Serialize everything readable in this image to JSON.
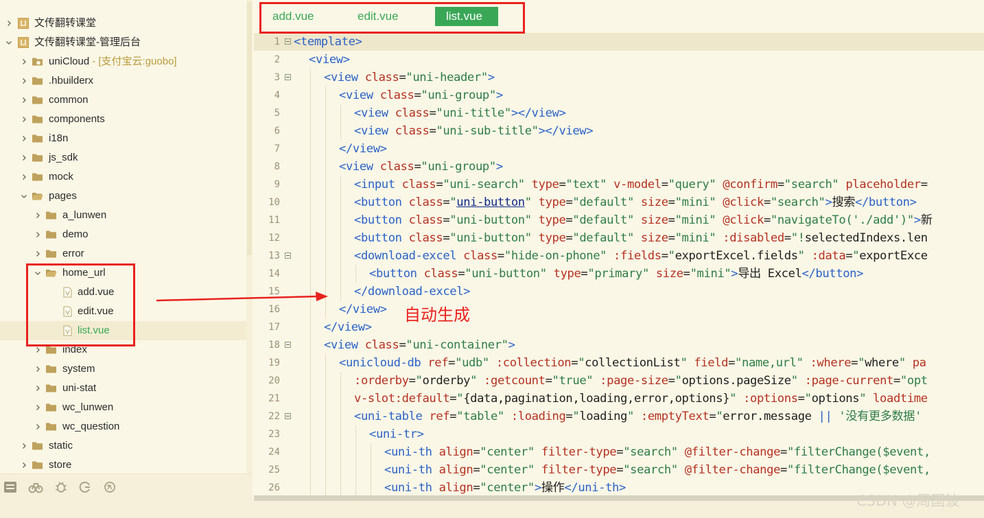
{
  "sidebar": {
    "projects": [
      {
        "name": "文传翻转课堂",
        "expanded": false
      },
      {
        "name": "文传翻转课堂-管理后台",
        "expanded": true
      }
    ],
    "tree": [
      {
        "label": "uniCloud",
        "extra": "- [支付宝云:guobo]",
        "type": "cloud-folder",
        "level": 1,
        "expanded": false
      },
      {
        "label": ".hbuilderx",
        "type": "folder",
        "level": 1,
        "expanded": false
      },
      {
        "label": "common",
        "type": "folder",
        "level": 1,
        "expanded": false
      },
      {
        "label": "components",
        "type": "folder",
        "level": 1,
        "expanded": false
      },
      {
        "label": "i18n",
        "type": "folder",
        "level": 1,
        "expanded": false
      },
      {
        "label": "js_sdk",
        "type": "folder",
        "level": 1,
        "expanded": false
      },
      {
        "label": "mock",
        "type": "folder",
        "level": 1,
        "expanded": false
      },
      {
        "label": "pages",
        "type": "folder",
        "level": 1,
        "expanded": true
      },
      {
        "label": "a_lunwen",
        "type": "folder",
        "level": 2,
        "expanded": false
      },
      {
        "label": "demo",
        "type": "folder",
        "level": 2,
        "expanded": false
      },
      {
        "label": "error",
        "type": "folder",
        "level": 2,
        "expanded": false
      },
      {
        "label": "home_url",
        "type": "folder",
        "level": 2,
        "expanded": true
      },
      {
        "label": "add.vue",
        "type": "file",
        "level": 3
      },
      {
        "label": "edit.vue",
        "type": "file",
        "level": 3
      },
      {
        "label": "list.vue",
        "type": "file",
        "level": 3,
        "selected": true
      },
      {
        "label": "index",
        "type": "folder",
        "level": 2,
        "expanded": false
      },
      {
        "label": "system",
        "type": "folder",
        "level": 2,
        "expanded": false
      },
      {
        "label": "uni-stat",
        "type": "folder",
        "level": 2,
        "expanded": false
      },
      {
        "label": "wc_lunwen",
        "type": "folder",
        "level": 2,
        "expanded": false
      },
      {
        "label": "wc_question",
        "type": "folder",
        "level": 2,
        "expanded": false
      },
      {
        "label": "static",
        "type": "folder",
        "level": 1,
        "expanded": false
      },
      {
        "label": "store",
        "type": "folder",
        "level": 1,
        "expanded": false
      }
    ],
    "toolbar_icons": [
      "project-manager-icon",
      "plugin-icon",
      "debug-icon",
      "git-icon",
      "translate-icon"
    ]
  },
  "editor": {
    "tabs": [
      {
        "label": "add.vue",
        "active": false
      },
      {
        "label": "edit.vue",
        "active": false
      },
      {
        "label": "list.vue",
        "active": true
      }
    ],
    "lines": [
      {
        "n": 1,
        "indent": 0,
        "fold": true,
        "current": true,
        "tokens": [
          [
            "tag",
            "<template>"
          ]
        ]
      },
      {
        "n": 2,
        "indent": 1,
        "tokens": [
          [
            "tag",
            "<view>"
          ]
        ]
      },
      {
        "n": 3,
        "indent": 2,
        "fold": true,
        "tokens": [
          [
            "tag",
            "<view "
          ],
          [
            "attr",
            "class"
          ],
          [
            "eq",
            "="
          ],
          [
            "val",
            "\"uni-header\""
          ],
          [
            "tag",
            ">"
          ]
        ]
      },
      {
        "n": 4,
        "indent": 3,
        "tokens": [
          [
            "tag",
            "<view "
          ],
          [
            "attr",
            "class"
          ],
          [
            "eq",
            "="
          ],
          [
            "val",
            "\"uni-group\""
          ],
          [
            "tag",
            ">"
          ]
        ]
      },
      {
        "n": 5,
        "indent": 4,
        "tokens": [
          [
            "tag",
            "<view "
          ],
          [
            "attr",
            "class"
          ],
          [
            "eq",
            "="
          ],
          [
            "val",
            "\"uni-title\""
          ],
          [
            "tag",
            "></view>"
          ]
        ]
      },
      {
        "n": 6,
        "indent": 4,
        "tokens": [
          [
            "tag",
            "<view "
          ],
          [
            "attr",
            "class"
          ],
          [
            "eq",
            "="
          ],
          [
            "val",
            "\"uni-sub-title\""
          ],
          [
            "tag",
            "></view>"
          ]
        ]
      },
      {
        "n": 7,
        "indent": 3,
        "tokens": [
          [
            "tag",
            "</view>"
          ]
        ]
      },
      {
        "n": 8,
        "indent": 3,
        "tokens": [
          [
            "tag",
            "<view "
          ],
          [
            "attr",
            "class"
          ],
          [
            "eq",
            "="
          ],
          [
            "val",
            "\"uni-group\""
          ],
          [
            "tag",
            ">"
          ]
        ]
      },
      {
        "n": 9,
        "indent": 4,
        "tokens": [
          [
            "tag",
            "<input "
          ],
          [
            "attr",
            "class"
          ],
          [
            "eq",
            "="
          ],
          [
            "val",
            "\"uni-search\" "
          ],
          [
            "attr",
            "type"
          ],
          [
            "eq",
            "="
          ],
          [
            "val",
            "\"text\" "
          ],
          [
            "attr",
            "v-model"
          ],
          [
            "eq",
            "="
          ],
          [
            "val",
            "\"query\" "
          ],
          [
            "attr",
            "@confirm"
          ],
          [
            "eq",
            "="
          ],
          [
            "val",
            "\"search\" "
          ],
          [
            "attr",
            "placeholder"
          ],
          [
            "eq",
            "="
          ]
        ]
      },
      {
        "n": 10,
        "indent": 4,
        "tokens": [
          [
            "tag",
            "<button "
          ],
          [
            "attr",
            "class"
          ],
          [
            "eq",
            "="
          ],
          [
            "val",
            "\""
          ],
          [
            "link",
            "uni-button"
          ],
          [
            "val",
            "\" "
          ],
          [
            "attr",
            "type"
          ],
          [
            "eq",
            "="
          ],
          [
            "val",
            "\"default\" "
          ],
          [
            "attr",
            "size"
          ],
          [
            "eq",
            "="
          ],
          [
            "val",
            "\"mini\" "
          ],
          [
            "attr",
            "@click"
          ],
          [
            "eq",
            "="
          ],
          [
            "val",
            "\"search\""
          ],
          [
            "tag",
            ">"
          ],
          [
            "text",
            "搜索"
          ],
          [
            "tag",
            "</button>"
          ]
        ]
      },
      {
        "n": 11,
        "indent": 4,
        "tokens": [
          [
            "tag",
            "<button "
          ],
          [
            "attr",
            "class"
          ],
          [
            "eq",
            "="
          ],
          [
            "val",
            "\"uni-button\" "
          ],
          [
            "attr",
            "type"
          ],
          [
            "eq",
            "="
          ],
          [
            "val",
            "\"default\" "
          ],
          [
            "attr",
            "size"
          ],
          [
            "eq",
            "="
          ],
          [
            "val",
            "\"mini\" "
          ],
          [
            "attr",
            "@click"
          ],
          [
            "eq",
            "="
          ],
          [
            "val",
            "\"navigateTo('./add')\""
          ],
          [
            "tag",
            ">"
          ],
          [
            "text",
            "新"
          ]
        ]
      },
      {
        "n": 12,
        "indent": 4,
        "tokens": [
          [
            "tag",
            "<button "
          ],
          [
            "attr",
            "class"
          ],
          [
            "eq",
            "="
          ],
          [
            "val",
            "\"uni-button\" "
          ],
          [
            "attr",
            "type"
          ],
          [
            "eq",
            "="
          ],
          [
            "val",
            "\"default\" "
          ],
          [
            "attr",
            "size"
          ],
          [
            "eq",
            "="
          ],
          [
            "val",
            "\"mini\" "
          ],
          [
            "attr",
            ":disabled"
          ],
          [
            "eq",
            "="
          ],
          [
            "val",
            "\"!"
          ],
          [
            "text",
            "selectedIndexs.len"
          ]
        ]
      },
      {
        "n": 13,
        "indent": 4,
        "fold": true,
        "tokens": [
          [
            "tag",
            "<download-excel "
          ],
          [
            "attr",
            "class"
          ],
          [
            "eq",
            "="
          ],
          [
            "val",
            "\"hide-on-phone\" "
          ],
          [
            "attr",
            ":fields"
          ],
          [
            "eq",
            "="
          ],
          [
            "val",
            "\""
          ],
          [
            "text",
            "exportExcel.fields"
          ],
          [
            "val",
            "\" "
          ],
          [
            "attr",
            ":data"
          ],
          [
            "eq",
            "="
          ],
          [
            "val",
            "\""
          ],
          [
            "text",
            "exportExce"
          ]
        ]
      },
      {
        "n": 14,
        "indent": 5,
        "tokens": [
          [
            "tag",
            "<button "
          ],
          [
            "attr",
            "class"
          ],
          [
            "eq",
            "="
          ],
          [
            "val",
            "\"uni-button\" "
          ],
          [
            "attr",
            "type"
          ],
          [
            "eq",
            "="
          ],
          [
            "val",
            "\"primary\" "
          ],
          [
            "attr",
            "size"
          ],
          [
            "eq",
            "="
          ],
          [
            "val",
            "\"mini\""
          ],
          [
            "tag",
            ">"
          ],
          [
            "text",
            "导出 Excel"
          ],
          [
            "tag",
            "</button>"
          ]
        ]
      },
      {
        "n": 15,
        "indent": 4,
        "tokens": [
          [
            "tag",
            "</download-excel>"
          ]
        ]
      },
      {
        "n": 16,
        "indent": 3,
        "tokens": [
          [
            "tag",
            "</view>"
          ]
        ]
      },
      {
        "n": 17,
        "indent": 2,
        "tokens": [
          [
            "tag",
            "</view>"
          ]
        ]
      },
      {
        "n": 18,
        "indent": 2,
        "fold": true,
        "tokens": [
          [
            "tag",
            "<view "
          ],
          [
            "attr",
            "class"
          ],
          [
            "eq",
            "="
          ],
          [
            "val",
            "\"uni-container\""
          ],
          [
            "tag",
            ">"
          ]
        ]
      },
      {
        "n": 19,
        "indent": 3,
        "tokens": [
          [
            "tag",
            "<unicloud-db "
          ],
          [
            "attr",
            "ref"
          ],
          [
            "eq",
            "="
          ],
          [
            "val",
            "\"udb\" "
          ],
          [
            "attr",
            ":collection"
          ],
          [
            "eq",
            "="
          ],
          [
            "val",
            "\""
          ],
          [
            "text",
            "collectionList"
          ],
          [
            "val",
            "\" "
          ],
          [
            "attr",
            "field"
          ],
          [
            "eq",
            "="
          ],
          [
            "val",
            "\"name,url\" "
          ],
          [
            "attr",
            ":where"
          ],
          [
            "eq",
            "="
          ],
          [
            "val",
            "\""
          ],
          [
            "text",
            "where"
          ],
          [
            "val",
            "\" "
          ],
          [
            "attr",
            "pa"
          ]
        ]
      },
      {
        "n": 20,
        "indent": 4,
        "tokens": [
          [
            "attr",
            ":orderby"
          ],
          [
            "eq",
            "="
          ],
          [
            "val",
            "\""
          ],
          [
            "text",
            "orderby"
          ],
          [
            "val",
            "\" "
          ],
          [
            "attr",
            ":getcount"
          ],
          [
            "eq",
            "="
          ],
          [
            "val",
            "\"true\" "
          ],
          [
            "attr",
            ":page-size"
          ],
          [
            "eq",
            "="
          ],
          [
            "val",
            "\""
          ],
          [
            "text",
            "options.pageSize"
          ],
          [
            "val",
            "\" "
          ],
          [
            "attr",
            ":page-current"
          ],
          [
            "eq",
            "="
          ],
          [
            "val",
            "\"opt"
          ]
        ]
      },
      {
        "n": 21,
        "indent": 4,
        "tokens": [
          [
            "attr",
            "v-slot:default"
          ],
          [
            "eq",
            "="
          ],
          [
            "val",
            "\""
          ],
          [
            "text",
            "{data,pagination,loading,error,options}"
          ],
          [
            "val",
            "\" "
          ],
          [
            "attr",
            ":options"
          ],
          [
            "eq",
            "="
          ],
          [
            "val",
            "\""
          ],
          [
            "text",
            "options"
          ],
          [
            "val",
            "\" "
          ],
          [
            "attr",
            "loadtime"
          ]
        ]
      },
      {
        "n": 22,
        "indent": 4,
        "fold": true,
        "tokens": [
          [
            "tag",
            "<uni-table "
          ],
          [
            "attr",
            "ref"
          ],
          [
            "eq",
            "="
          ],
          [
            "val",
            "\"table\" "
          ],
          [
            "attr",
            ":loading"
          ],
          [
            "eq",
            "="
          ],
          [
            "val",
            "\""
          ],
          [
            "text",
            "loading"
          ],
          [
            "val",
            "\" "
          ],
          [
            "attr",
            ":emptyText"
          ],
          [
            "eq",
            "="
          ],
          [
            "val",
            "\""
          ],
          [
            "text",
            "error.message "
          ],
          [
            "tag",
            "||"
          ],
          [
            "val",
            " '没有更多数据'"
          ]
        ]
      },
      {
        "n": 23,
        "indent": 5,
        "tokens": [
          [
            "tag",
            "<uni-tr>"
          ]
        ]
      },
      {
        "n": 24,
        "indent": 6,
        "tokens": [
          [
            "tag",
            "<uni-th "
          ],
          [
            "attr",
            "align"
          ],
          [
            "eq",
            "="
          ],
          [
            "val",
            "\"center\" "
          ],
          [
            "attr",
            "filter-type"
          ],
          [
            "eq",
            "="
          ],
          [
            "val",
            "\"search\" "
          ],
          [
            "attr",
            "@filter-change"
          ],
          [
            "eq",
            "="
          ],
          [
            "val",
            "\"filterChange($event,"
          ]
        ]
      },
      {
        "n": 25,
        "indent": 6,
        "tokens": [
          [
            "tag",
            "<uni-th "
          ],
          [
            "attr",
            "align"
          ],
          [
            "eq",
            "="
          ],
          [
            "val",
            "\"center\" "
          ],
          [
            "attr",
            "filter-type"
          ],
          [
            "eq",
            "="
          ],
          [
            "val",
            "\"search\" "
          ],
          [
            "attr",
            "@filter-change"
          ],
          [
            "eq",
            "="
          ],
          [
            "val",
            "\"filterChange($event,"
          ]
        ]
      },
      {
        "n": 26,
        "indent": 6,
        "tokens": [
          [
            "tag",
            "<uni-th "
          ],
          [
            "attr",
            "align"
          ],
          [
            "eq",
            "="
          ],
          [
            "val",
            "\"center\""
          ],
          [
            "tag",
            ">"
          ],
          [
            "text",
            "操作"
          ],
          [
            "tag",
            "</uni-th>"
          ]
        ]
      }
    ]
  },
  "annotation": {
    "auto_generated_label": "自动生成",
    "color": "#e8221e"
  },
  "watermark": "CSDN @周国波",
  "colors": {
    "accent_green": "#3aa757",
    "background": "#fbf7e6",
    "tag_blue": "#2b62c8",
    "attr_red": "#b53222",
    "value_green": "#2f7c48"
  }
}
